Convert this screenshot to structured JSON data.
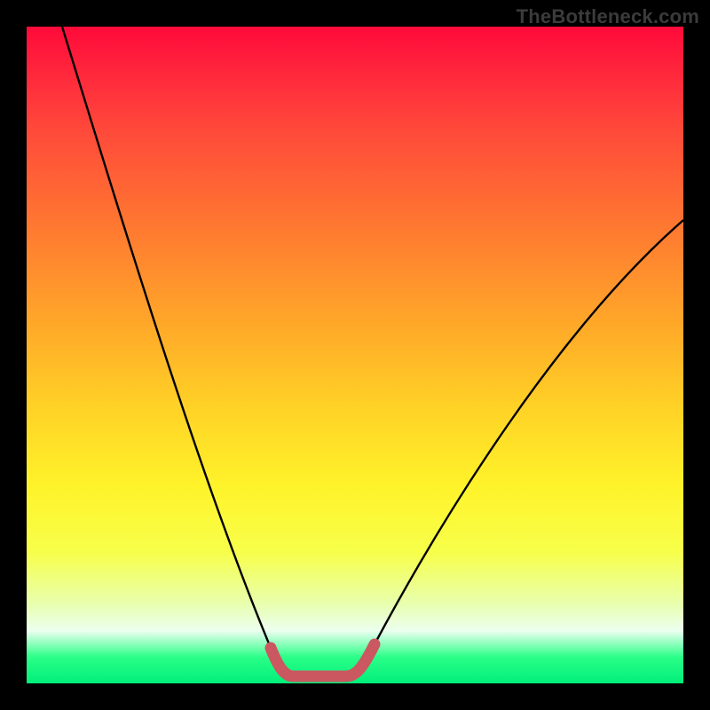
{
  "watermark": "TheBottleneck.com",
  "colors": {
    "background": "#000000",
    "gradient_top": "#ff0a3a",
    "gradient_mid": "#fff32a",
    "gradient_bottom": "#00ef7a",
    "curve": "#000000",
    "valley_segment": "#cb5760"
  },
  "chart_data": {
    "type": "line",
    "title": "",
    "xlabel": "",
    "ylabel": "",
    "xlim": [
      0,
      100
    ],
    "ylim": [
      0,
      100
    ],
    "series": [
      {
        "name": "bottleneck-curve",
        "x": [
          0,
          5,
          10,
          15,
          20,
          25,
          30,
          35,
          38,
          40,
          43,
          47,
          50,
          52,
          55,
          60,
          65,
          70,
          75,
          80,
          85,
          90,
          95,
          100
        ],
        "y": [
          100,
          89,
          78,
          67,
          56,
          45,
          34,
          22,
          12,
          4,
          0,
          0,
          0,
          4,
          11,
          18,
          26,
          33,
          40,
          47,
          53,
          59,
          65,
          71
        ]
      }
    ],
    "annotations": [
      {
        "name": "valley-highlight",
        "x_range": [
          38,
          52
        ],
        "y_range": [
          0,
          5
        ]
      }
    ]
  }
}
